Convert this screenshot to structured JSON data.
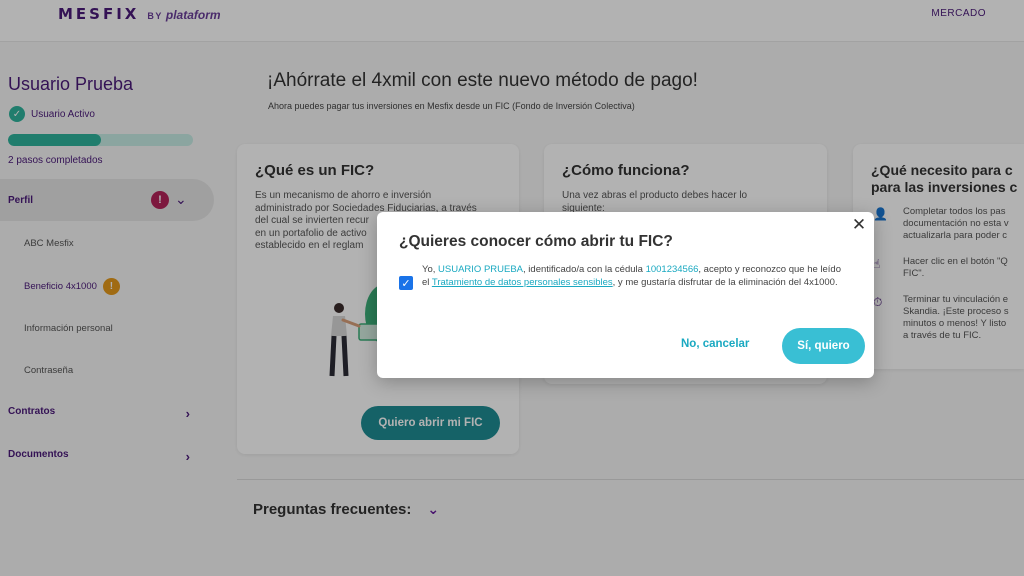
{
  "header": {
    "logo_main": "MESFIX",
    "logo_by": "BY",
    "logo_sub": "plataform",
    "nav_market": "MERCADO"
  },
  "sidebar": {
    "user_name": "Usuario Prueba",
    "status": "Usuario Activo",
    "progress_fraction": 0.5,
    "steps_completed": "2 pasos completados",
    "perfil_label": "Perfil",
    "perfil_badge": "!",
    "sub_items": [
      "ABC Mesfix",
      "Beneficio 4x1000",
      "Información personal",
      "Contraseña"
    ],
    "warn_badge": "!",
    "contratos": "Contratos",
    "documentos": "Documentos"
  },
  "main": {
    "headline": "¡Ahórrate el 4xmil con este nuevo método de pago!",
    "subline": "Ahora puedes pagar tus inversiones en Mesfix desde un FIC (Fondo de Inversión Colectiva)",
    "card1": {
      "title": "¿Qué es un FIC?",
      "body": [
        "Es un mecanismo de ahorro e inversión",
        "administrado por Sociedades Fiduciarias, a través",
        "del cual se invierten recur",
        "en un portafolio de activo",
        "establecido en el reglam"
      ],
      "button": "Quiero abrir mi FIC"
    },
    "card2": {
      "title": "¿Cómo funciona?",
      "body": [
        "Una vez abras el producto debes hacer lo",
        "siguiente:"
      ]
    },
    "card3": {
      "title_lines": [
        "¿Qué necesito para c",
        "para las inversiones c"
      ],
      "items": [
        {
          "lines": [
            "Completar todos los pas",
            "documentación no esta v",
            "actualizarla para poder c"
          ]
        },
        {
          "lines": [
            "Hacer clic en el botón \"Q",
            "FIC\"."
          ]
        },
        {
          "lines": [
            "Terminar tu vinculación e",
            "Skandia. ¡Este proceso s",
            "minutos o menos! Y listo",
            "a través de tu FIC."
          ]
        }
      ]
    },
    "faq": "Preguntas frecuentes:"
  },
  "modal": {
    "title": "¿Quieres conocer cómo abrir tu FIC?",
    "text_parts": {
      "p1": "Yo, ",
      "name": "USUARIO PRUEBA",
      "p2": ", identificado/a con la cédula ",
      "id": "1001234566",
      "p3": ", acepto y reconozco que he leído el ",
      "link": "Tratamiento de datos personales sensibles",
      "p4": ", y me gustaría disfrutar de la eliminación del 4x1000."
    },
    "checked": true,
    "cancel": "No, cancelar",
    "confirm": "Sí, quiero"
  },
  "colors": {
    "brand_purple": "#4b1a7a",
    "teal": "#2fb39c",
    "cyan": "#39bfd4",
    "alert": "#b4235a",
    "warn": "#e69a1c"
  }
}
